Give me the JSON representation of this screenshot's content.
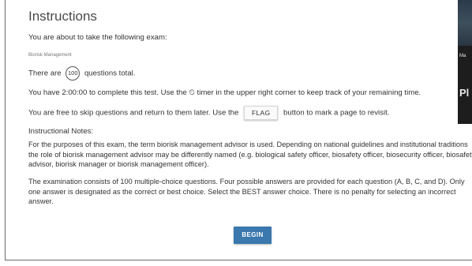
{
  "title": "Instructions",
  "intro": "You are about to take the following exam:",
  "exam_name": "Biorisk Management",
  "questions": {
    "prefix": "There are",
    "count": "100",
    "suffix": "questions total."
  },
  "timer_line": "You have 2:00:00 to complete this test. Use the ⏲ timer in the upper right corner to keep track of your remaining time.",
  "skip": {
    "prefix": "You are free to skip questions and return to them later. Use the",
    "flag_label": "FLAG",
    "suffix": "button to mark a page to revisit."
  },
  "notes_heading": "Instructional Notes:",
  "note1": "For the purposes of this exam, the term biorisk management advisor is used. Depending on national guidelines and institutional traditions the role of biorisk management advisor may be differently named (e.g. biological safety officer, biosafety officer, biosecurity officer, biosafety advisor, biorisk manager or biorisk management officer).",
  "note2": "The examination consists of 100 multiple-choice questions. Four possible answers are provided for each question (A, B, C, and D). Only one answer is designated as the correct or best choice. Select the BEST answer choice. There is no penalty for selecting an incorrect answer.",
  "begin_label": "BEGIN",
  "side_panel": {
    "text_top": "Ma",
    "text_mid": "Pl"
  },
  "colors": {
    "begin_button": "#3a78ad",
    "side_panel": "#1d1d1d"
  }
}
